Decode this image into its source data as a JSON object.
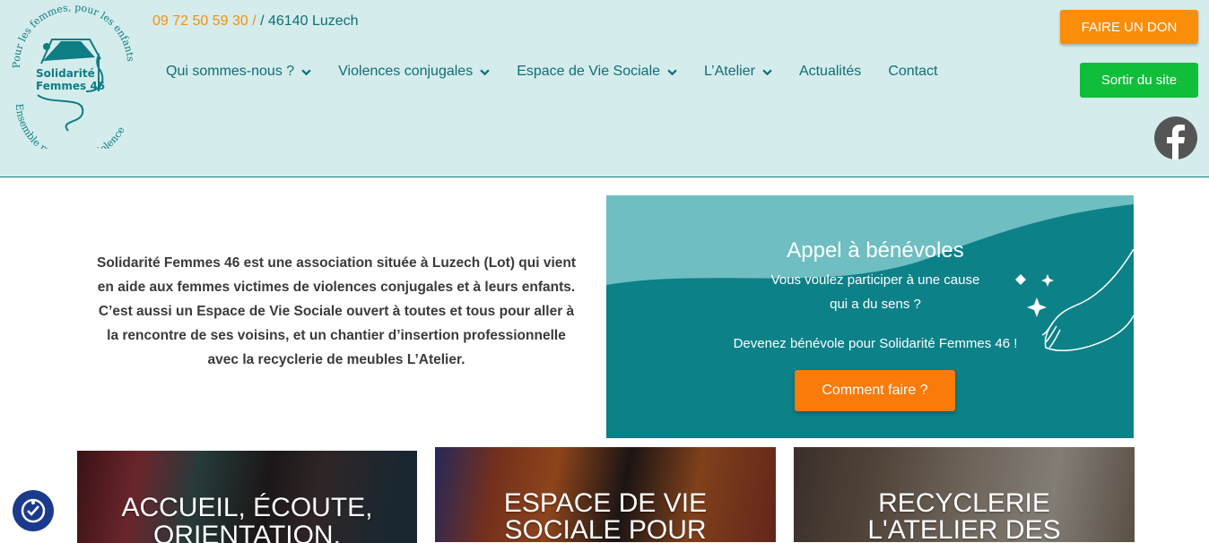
{
  "header": {
    "logo": {
      "name_line1": "Solidarité",
      "name_line2": "Femmes 46",
      "arc_top": "Pour les femmes, pour les enfants,",
      "arc_bottom": "Ensemble refusons la violence"
    },
    "phone": "09 72 50 59 30 /",
    "city": "/ 46140 Luzech",
    "nav": [
      {
        "label": "Qui sommes-nous ?",
        "has_dropdown": true
      },
      {
        "label": "Violences conjugales",
        "has_dropdown": true
      },
      {
        "label": "Espace de Vie Sociale",
        "has_dropdown": true
      },
      {
        "label": "L’Atelier",
        "has_dropdown": true
      },
      {
        "label": "Actualités",
        "has_dropdown": false
      },
      {
        "label": "Contact",
        "has_dropdown": false
      }
    ],
    "donate_label": "FAIRE UN DON",
    "exit_label": "Sortir du site",
    "social_icon": "facebook-icon"
  },
  "intro": {
    "lines": [
      "Solidarité Femmes 46 est une association située à Luzech (Lot) qui vient",
      "en aide aux femmes victimes de violences conjugales et à leurs enfants.",
      "C’est aussi un Espace de Vie Sociale ouvert à toutes et tous pour aller à",
      "la rencontre de ses voisins, et un chantier d’insertion professionnelle",
      "avec la recyclerie de meubles L’Atelier."
    ]
  },
  "banner": {
    "title": "Appel à bénévoles",
    "sub1": "Vous voulez participer à une cause",
    "sub2": "qui a du sens ?",
    "sub3": "Devenez bénévole pour Solidarité Femmes 46 !",
    "button": "Comment faire ?"
  },
  "cards": [
    {
      "line1": "ACCUEIL, ÉCOUTE,",
      "line2": "ORIENTATION,"
    },
    {
      "line1": "ESPACE DE VIE",
      "line2": "SOCIALE POUR"
    },
    {
      "line1": "RECYCLERIE",
      "line2": "L'ATELIER DES"
    }
  ],
  "colors": {
    "header_bg": "#d5ecec",
    "teal": "#0e6e76",
    "orange": "#fa8d0a",
    "green": "#0fbf3a",
    "banner_bg": "#0c8188"
  }
}
